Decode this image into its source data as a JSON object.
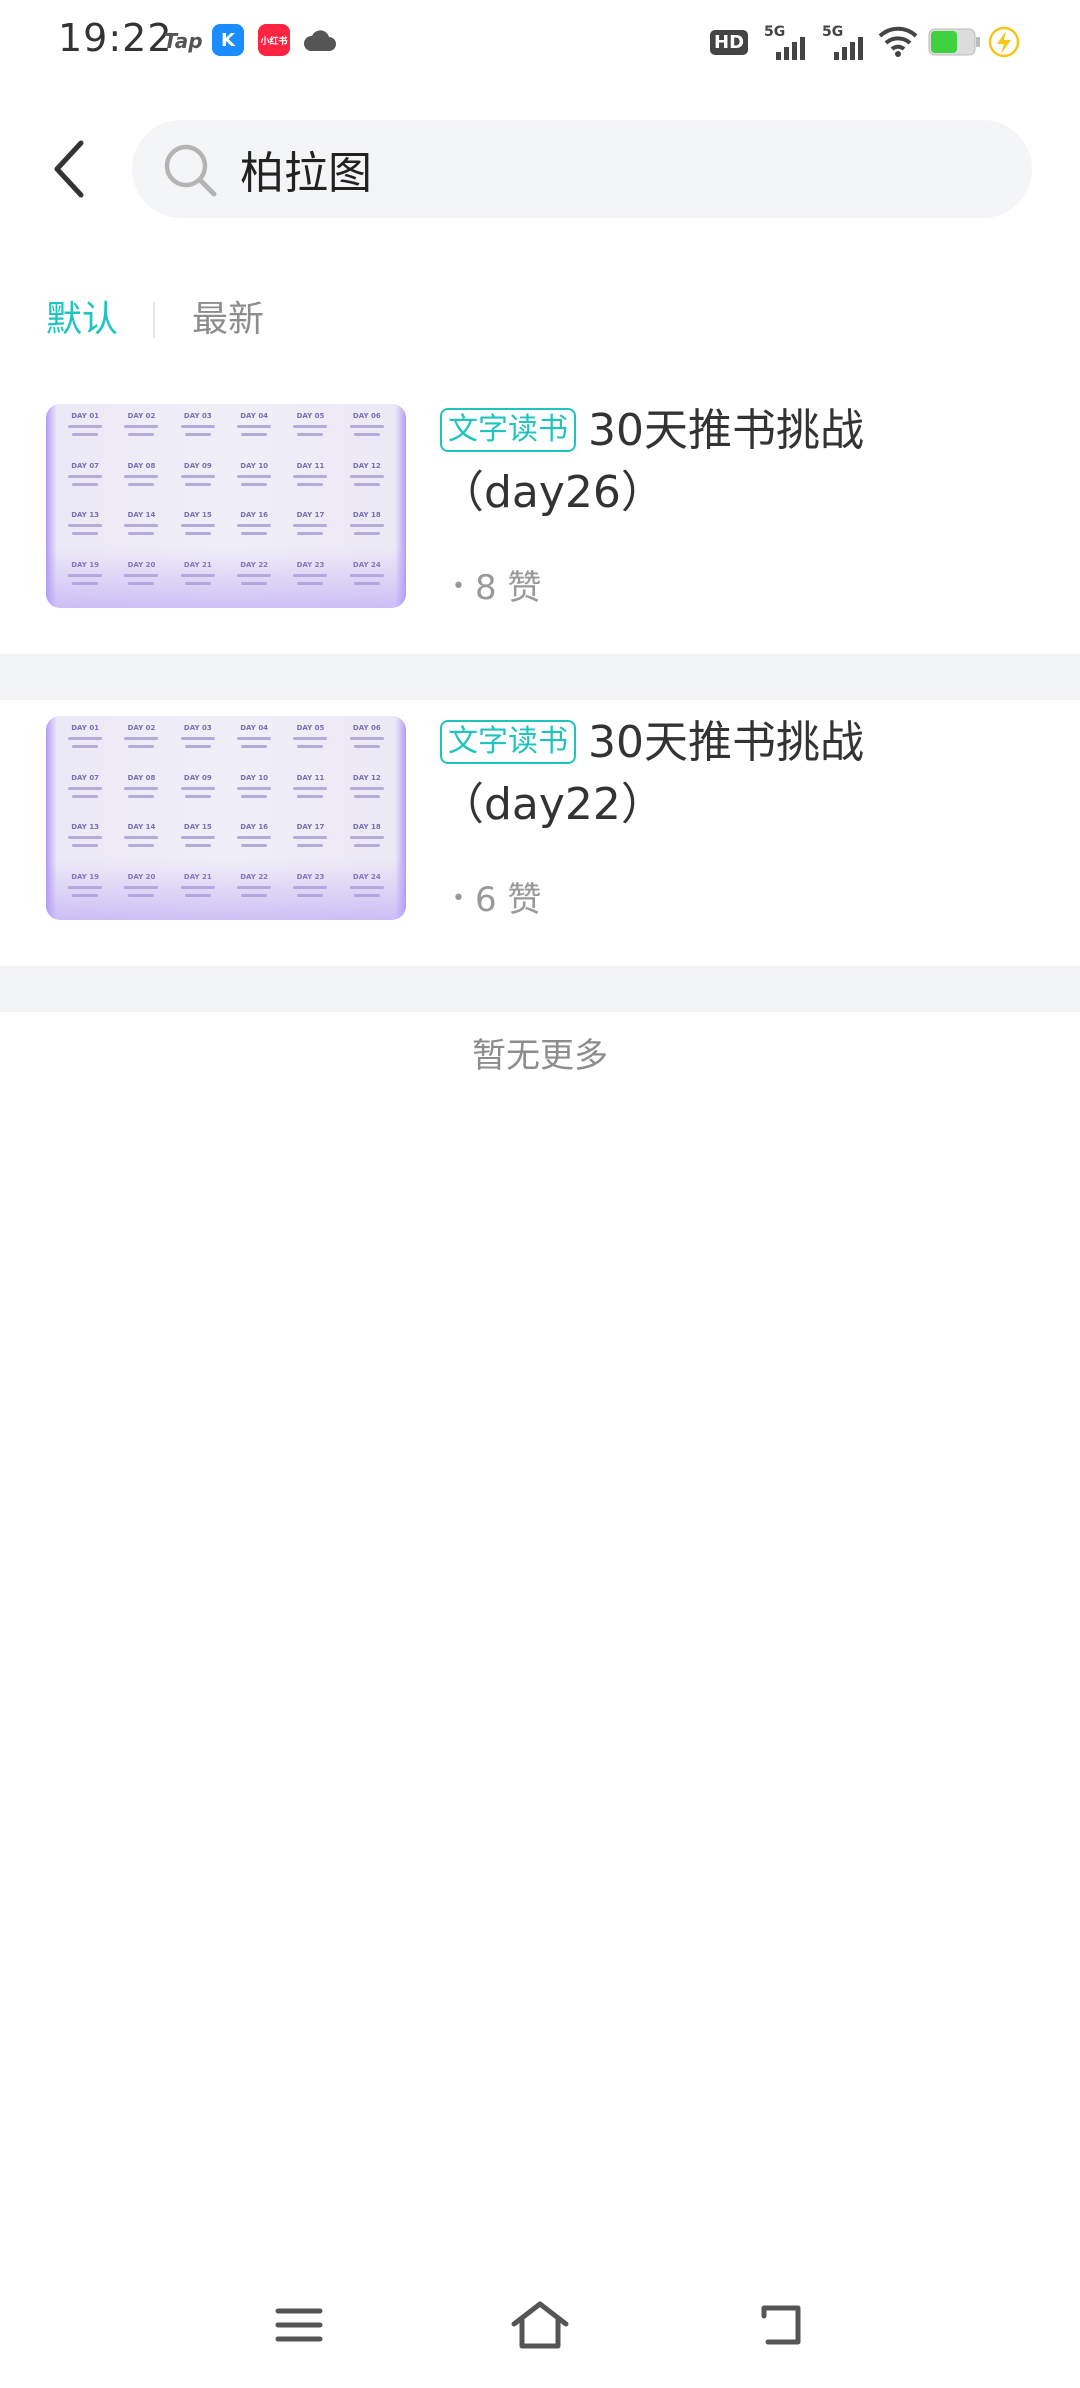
{
  "status_bar": {
    "time": "19:22",
    "notifications": [
      {
        "icon": "taptap-icon",
        "text": "Tap"
      },
      {
        "icon": "k-app-icon",
        "text": "K"
      },
      {
        "icon": "xiaohongshu-icon",
        "text": "小红书"
      },
      {
        "icon": "cloud-icon"
      }
    ],
    "hd_label": "HD",
    "signal_1_label": "5G",
    "signal_2_label": "5G",
    "battery_color": "#3fd13f",
    "charging_color": "#f5c518"
  },
  "search": {
    "query": "柏拉图",
    "placeholder": ""
  },
  "tabs": [
    {
      "label": "默认",
      "active": true
    },
    {
      "label": "最新",
      "active": false
    }
  ],
  "results": [
    {
      "tag": "文字读书",
      "title": "30天推书挑战（day26）",
      "likes": "8 赞",
      "thumbnail_days": [
        "DAY 01",
        "DAY 02",
        "DAY 03",
        "DAY 04",
        "DAY 05",
        "DAY 06",
        "DAY 07",
        "DAY 08",
        "DAY 09",
        "DAY 10",
        "DAY 11",
        "DAY 12",
        "DAY 13",
        "DAY 14",
        "DAY 15",
        "DAY 16",
        "DAY 17",
        "DAY 18",
        "DAY 19",
        "DAY 20",
        "DAY 21",
        "DAY 22",
        "DAY 23",
        "DAY 24"
      ]
    },
    {
      "tag": "文字读书",
      "title": "30天推书挑战（day22）",
      "likes": "6 赞",
      "thumbnail_days": [
        "DAY 01",
        "DAY 02",
        "DAY 03",
        "DAY 04",
        "DAY 05",
        "DAY 06",
        "DAY 07",
        "DAY 08",
        "DAY 09",
        "DAY 10",
        "DAY 11",
        "DAY 12",
        "DAY 13",
        "DAY 14",
        "DAY 15",
        "DAY 16",
        "DAY 17",
        "DAY 18",
        "DAY 19",
        "DAY 20",
        "DAY 21",
        "DAY 22",
        "DAY 23",
        "DAY 24"
      ]
    }
  ],
  "footer_text": "暂无更多",
  "colors": {
    "accent": "#1fc4bf",
    "muted": "#8d8d8d",
    "divider": "#f3f4f6"
  }
}
